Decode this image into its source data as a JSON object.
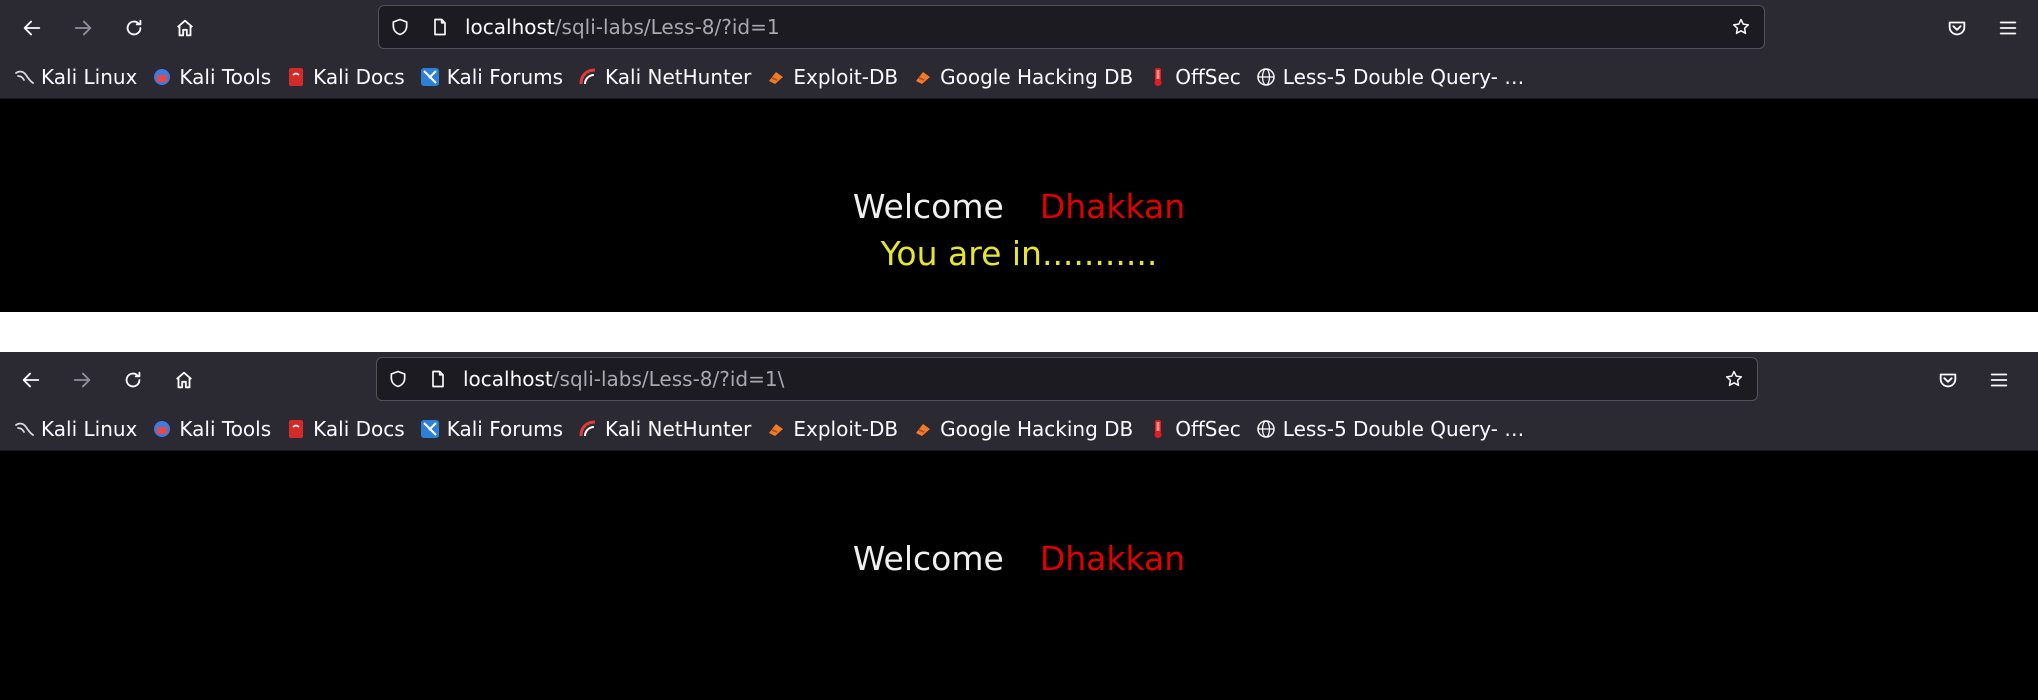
{
  "screenshots": [
    {
      "url_host": "localhost",
      "url_path": "/sqli-labs/Less-8/?id=1",
      "bookmarks": [
        {
          "label": "Kali Linux",
          "icon": "kali-dragon-icon"
        },
        {
          "label": "Kali Tools",
          "icon": "kali-tools-icon"
        },
        {
          "label": "Kali Docs",
          "icon": "kali-docs-icon"
        },
        {
          "label": "Kali Forums",
          "icon": "kali-forums-icon"
        },
        {
          "label": "Kali NetHunter",
          "icon": "nethunter-icon"
        },
        {
          "label": "Exploit-DB",
          "icon": "exploit-db-icon"
        },
        {
          "label": "Google Hacking DB",
          "icon": "ghdb-icon"
        },
        {
          "label": "OffSec",
          "icon": "offsec-icon"
        },
        {
          "label": "Less-5 Double Query- …",
          "icon": "globe-icon"
        }
      ],
      "welcome": "Welcome",
      "name": "Dhakkan",
      "message": "You are in..........."
    },
    {
      "url_host": "localhost",
      "url_path": "/sqli-labs/Less-8/?id=1\\",
      "bookmarks": [
        {
          "label": "Kali Linux",
          "icon": "kali-dragon-icon"
        },
        {
          "label": "Kali Tools",
          "icon": "kali-tools-icon"
        },
        {
          "label": "Kali Docs",
          "icon": "kali-docs-icon"
        },
        {
          "label": "Kali Forums",
          "icon": "kali-forums-icon"
        },
        {
          "label": "Kali NetHunter",
          "icon": "nethunter-icon"
        },
        {
          "label": "Exploit-DB",
          "icon": "exploit-db-icon"
        },
        {
          "label": "Google Hacking DB",
          "icon": "ghdb-icon"
        },
        {
          "label": "OffSec",
          "icon": "offsec-icon"
        },
        {
          "label": "Less-5 Double Query- …",
          "icon": "globe-icon"
        }
      ],
      "welcome": "Welcome",
      "name": "Dhakkan"
    }
  ]
}
